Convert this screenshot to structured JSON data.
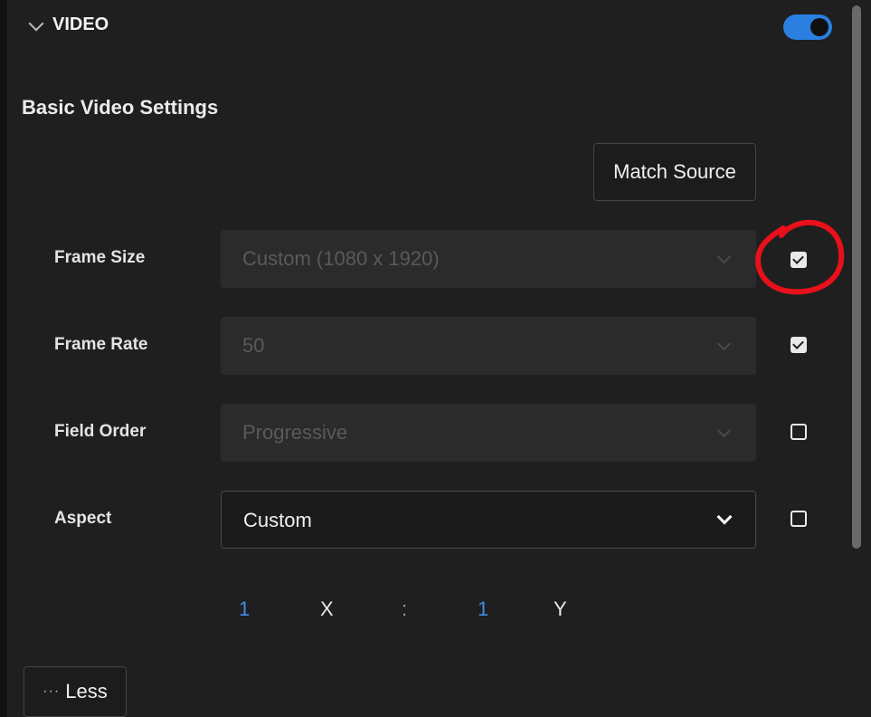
{
  "section": {
    "title": "VIDEO",
    "enabled": true
  },
  "basic_settings": {
    "heading": "Basic Video Settings",
    "match_source_label": "Match Source"
  },
  "rows": [
    {
      "label": "Frame Size",
      "value": "Custom (1080 x 1920)",
      "state": "disabled",
      "checked": true
    },
    {
      "label": "Frame Rate",
      "value": "50",
      "state": "disabled",
      "checked": true
    },
    {
      "label": "Field Order",
      "value": "Progressive",
      "state": "disabled",
      "checked": false
    },
    {
      "label": "Aspect",
      "value": "Custom",
      "state": "enabled",
      "checked": false
    }
  ],
  "aspect_ratio": {
    "x_value": "1",
    "x_label": "X",
    "separator": ":",
    "y_value": "1",
    "y_label": "Y"
  },
  "less_button": {
    "dots": "···",
    "label": "Less"
  },
  "colors": {
    "accent": "#2a7fe0",
    "annotation_circle": "#e8101a",
    "background": "#1f1f1f"
  },
  "icons": [
    "chevron-down-icon",
    "toggle-switch",
    "dropdown-caret-icon",
    "checkbox",
    "more-dots-icon"
  ]
}
